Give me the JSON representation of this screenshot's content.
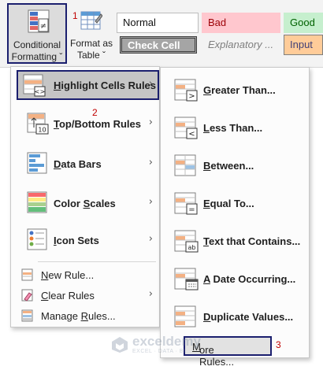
{
  "ribbon": {
    "conditional_formatting": {
      "line1": "Conditional",
      "line2": "Formatting ˇ"
    },
    "format_as_table": {
      "line1": "Format as",
      "line2": "Table ˇ"
    },
    "styles": {
      "normal": "Normal",
      "bad": "Bad",
      "good": "Good",
      "check_cell": "Check Cell",
      "explanatory": "Explanatory ...",
      "input": "Input"
    }
  },
  "steps": {
    "one": "1",
    "two": "2",
    "three": "3"
  },
  "main_menu": {
    "items": [
      {
        "label_pre": "",
        "label_u": "H",
        "label_post": "ighlight Cells Rules",
        "icon": "highlight-cells-icon",
        "has_submenu": true
      },
      {
        "label_pre": "",
        "label_u": "T",
        "label_post": "op/Bottom Rules",
        "icon": "top-bottom-icon",
        "has_submenu": true
      },
      {
        "label_pre": "",
        "label_u": "D",
        "label_post": "ata Bars",
        "icon": "data-bars-icon",
        "has_submenu": true
      },
      {
        "label_pre": "Color ",
        "label_u": "S",
        "label_post": "cales",
        "icon": "color-scales-icon",
        "has_submenu": true
      },
      {
        "label_pre": "",
        "label_u": "I",
        "label_post": "con Sets",
        "icon": "icon-sets-icon",
        "has_submenu": true
      }
    ],
    "commands": [
      {
        "label_pre": "",
        "label_u": "N",
        "label_post": "ew Rule...",
        "icon": "new-rule-icon",
        "has_submenu": false
      },
      {
        "label_pre": "",
        "label_u": "C",
        "label_post": "lear Rules",
        "icon": "clear-rules-icon",
        "has_submenu": true
      },
      {
        "label_pre": "Manage ",
        "label_u": "R",
        "label_post": "ules...",
        "icon": "manage-rules-icon",
        "has_submenu": false
      }
    ]
  },
  "sub_menu": {
    "items": [
      {
        "label_pre": "",
        "label_u": "G",
        "label_post": "reater Than...",
        "icon": "greater-than-icon",
        "symbol": ">"
      },
      {
        "label_pre": "",
        "label_u": "L",
        "label_post": "ess Than...",
        "icon": "less-than-icon",
        "symbol": "<"
      },
      {
        "label_pre": "",
        "label_u": "B",
        "label_post": "etween...",
        "icon": "between-icon",
        "symbol": ""
      },
      {
        "label_pre": "",
        "label_u": "E",
        "label_post": "qual To...",
        "icon": "equal-to-icon",
        "symbol": "="
      },
      {
        "label_pre": "",
        "label_u": "T",
        "label_post": "ext that Contains...",
        "icon": "text-contains-icon",
        "symbol": "ab"
      },
      {
        "label_pre": "",
        "label_u": "A",
        "label_post": " Date Occurring...",
        "icon": "date-occurring-icon",
        "symbol": ""
      },
      {
        "label_pre": "",
        "label_u": "D",
        "label_post": "uplicate Values...",
        "icon": "duplicate-values-icon",
        "symbol": ""
      }
    ],
    "more_rules": {
      "label_pre": "",
      "label_u": "M",
      "label_post": "ore Rules..."
    }
  },
  "watermark": {
    "name": "exceldemy",
    "tagline": "EXCEL · DATA · BI"
  },
  "colors": {
    "accent_border": "#1b1f6e",
    "step_red": "#c00000",
    "highlight_gray": "#c5c5c5"
  }
}
